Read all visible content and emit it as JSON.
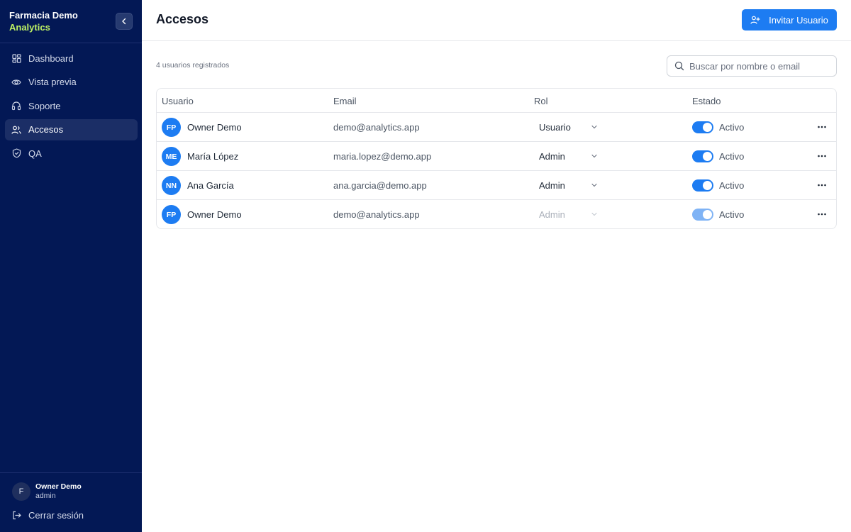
{
  "brand": {
    "line1": "Farmacia Demo",
    "line2": "Analytics",
    "accent_color": "#bef264"
  },
  "sidebar": {
    "background": "#031855",
    "collapse_icon": "chevron-left-icon",
    "items": [
      {
        "label": "Dashboard",
        "icon": "grid-icon",
        "active": false
      },
      {
        "label": "Vista previa",
        "icon": "eye-icon",
        "active": false
      },
      {
        "label": "Soporte",
        "icon": "headphones-icon",
        "active": false
      },
      {
        "label": "Accesos",
        "icon": "users-icon",
        "active": true
      },
      {
        "label": "QA",
        "icon": "shield-check-icon",
        "active": false
      }
    ],
    "profile": {
      "initial": "F",
      "name": "Owner Demo",
      "role": "admin"
    },
    "logout_label": "Cerrar sesión"
  },
  "header": {
    "title": "Accesos",
    "invite_label": "Invitar Usuario",
    "invite_icon": "user-plus-icon",
    "accent_color": "#1d7cf2"
  },
  "main": {
    "count_text": "4 usuarios registrados",
    "search": {
      "placeholder": "Buscar por nombre o email",
      "value": ""
    },
    "table": {
      "columns": [
        "Usuario",
        "Email",
        "Rol",
        "Estado"
      ],
      "rows": [
        {
          "initials": "FP",
          "name": "Owner Demo",
          "email": "demo@analytics.app",
          "role": "Usuario",
          "role_disabled": false,
          "active": true,
          "status": "Activo"
        },
        {
          "initials": "ME",
          "name": "María López",
          "email": "maria.lopez@demo.app",
          "role": "Admin",
          "role_disabled": false,
          "active": true,
          "status": "Activo"
        },
        {
          "initials": "NN",
          "name": "Ana García",
          "email": "ana.garcia@demo.app",
          "role": "Admin",
          "role_disabled": false,
          "active": true,
          "status": "Activo"
        },
        {
          "initials": "FP",
          "name": "Owner Demo",
          "email": "demo@analytics.app",
          "role": "Admin",
          "role_disabled": true,
          "active": true,
          "status": "Activo"
        }
      ]
    }
  }
}
